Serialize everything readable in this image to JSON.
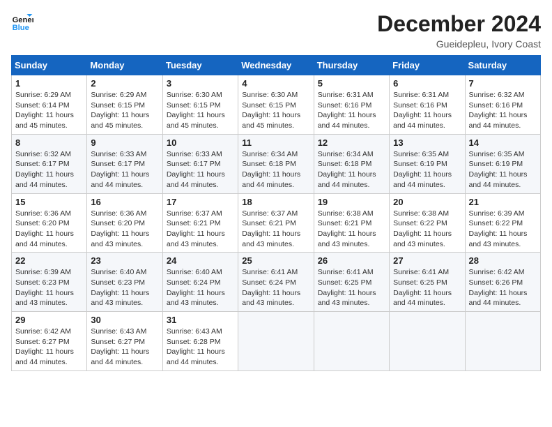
{
  "header": {
    "logo_line1": "General",
    "logo_line2": "Blue",
    "month_title": "December 2024",
    "location": "Gueidepleu, Ivory Coast"
  },
  "weekdays": [
    "Sunday",
    "Monday",
    "Tuesday",
    "Wednesday",
    "Thursday",
    "Friday",
    "Saturday"
  ],
  "weeks": [
    [
      {
        "day": "1",
        "sunrise": "6:29 AM",
        "sunset": "6:14 PM",
        "daylight": "11 hours and 45 minutes."
      },
      {
        "day": "2",
        "sunrise": "6:29 AM",
        "sunset": "6:15 PM",
        "daylight": "11 hours and 45 minutes."
      },
      {
        "day": "3",
        "sunrise": "6:30 AM",
        "sunset": "6:15 PM",
        "daylight": "11 hours and 45 minutes."
      },
      {
        "day": "4",
        "sunrise": "6:30 AM",
        "sunset": "6:15 PM",
        "daylight": "11 hours and 45 minutes."
      },
      {
        "day": "5",
        "sunrise": "6:31 AM",
        "sunset": "6:16 PM",
        "daylight": "11 hours and 44 minutes."
      },
      {
        "day": "6",
        "sunrise": "6:31 AM",
        "sunset": "6:16 PM",
        "daylight": "11 hours and 44 minutes."
      },
      {
        "day": "7",
        "sunrise": "6:32 AM",
        "sunset": "6:16 PM",
        "daylight": "11 hours and 44 minutes."
      }
    ],
    [
      {
        "day": "8",
        "sunrise": "6:32 AM",
        "sunset": "6:17 PM",
        "daylight": "11 hours and 44 minutes."
      },
      {
        "day": "9",
        "sunrise": "6:33 AM",
        "sunset": "6:17 PM",
        "daylight": "11 hours and 44 minutes."
      },
      {
        "day": "10",
        "sunrise": "6:33 AM",
        "sunset": "6:17 PM",
        "daylight": "11 hours and 44 minutes."
      },
      {
        "day": "11",
        "sunrise": "6:34 AM",
        "sunset": "6:18 PM",
        "daylight": "11 hours and 44 minutes."
      },
      {
        "day": "12",
        "sunrise": "6:34 AM",
        "sunset": "6:18 PM",
        "daylight": "11 hours and 44 minutes."
      },
      {
        "day": "13",
        "sunrise": "6:35 AM",
        "sunset": "6:19 PM",
        "daylight": "11 hours and 44 minutes."
      },
      {
        "day": "14",
        "sunrise": "6:35 AM",
        "sunset": "6:19 PM",
        "daylight": "11 hours and 44 minutes."
      }
    ],
    [
      {
        "day": "15",
        "sunrise": "6:36 AM",
        "sunset": "6:20 PM",
        "daylight": "11 hours and 44 minutes."
      },
      {
        "day": "16",
        "sunrise": "6:36 AM",
        "sunset": "6:20 PM",
        "daylight": "11 hours and 43 minutes."
      },
      {
        "day": "17",
        "sunrise": "6:37 AM",
        "sunset": "6:21 PM",
        "daylight": "11 hours and 43 minutes."
      },
      {
        "day": "18",
        "sunrise": "6:37 AM",
        "sunset": "6:21 PM",
        "daylight": "11 hours and 43 minutes."
      },
      {
        "day": "19",
        "sunrise": "6:38 AM",
        "sunset": "6:21 PM",
        "daylight": "11 hours and 43 minutes."
      },
      {
        "day": "20",
        "sunrise": "6:38 AM",
        "sunset": "6:22 PM",
        "daylight": "11 hours and 43 minutes."
      },
      {
        "day": "21",
        "sunrise": "6:39 AM",
        "sunset": "6:22 PM",
        "daylight": "11 hours and 43 minutes."
      }
    ],
    [
      {
        "day": "22",
        "sunrise": "6:39 AM",
        "sunset": "6:23 PM",
        "daylight": "11 hours and 43 minutes."
      },
      {
        "day": "23",
        "sunrise": "6:40 AM",
        "sunset": "6:23 PM",
        "daylight": "11 hours and 43 minutes."
      },
      {
        "day": "24",
        "sunrise": "6:40 AM",
        "sunset": "6:24 PM",
        "daylight": "11 hours and 43 minutes."
      },
      {
        "day": "25",
        "sunrise": "6:41 AM",
        "sunset": "6:24 PM",
        "daylight": "11 hours and 43 minutes."
      },
      {
        "day": "26",
        "sunrise": "6:41 AM",
        "sunset": "6:25 PM",
        "daylight": "11 hours and 43 minutes."
      },
      {
        "day": "27",
        "sunrise": "6:41 AM",
        "sunset": "6:25 PM",
        "daylight": "11 hours and 44 minutes."
      },
      {
        "day": "28",
        "sunrise": "6:42 AM",
        "sunset": "6:26 PM",
        "daylight": "11 hours and 44 minutes."
      }
    ],
    [
      {
        "day": "29",
        "sunrise": "6:42 AM",
        "sunset": "6:27 PM",
        "daylight": "11 hours and 44 minutes."
      },
      {
        "day": "30",
        "sunrise": "6:43 AM",
        "sunset": "6:27 PM",
        "daylight": "11 hours and 44 minutes."
      },
      {
        "day": "31",
        "sunrise": "6:43 AM",
        "sunset": "6:28 PM",
        "daylight": "11 hours and 44 minutes."
      },
      null,
      null,
      null,
      null
    ]
  ]
}
